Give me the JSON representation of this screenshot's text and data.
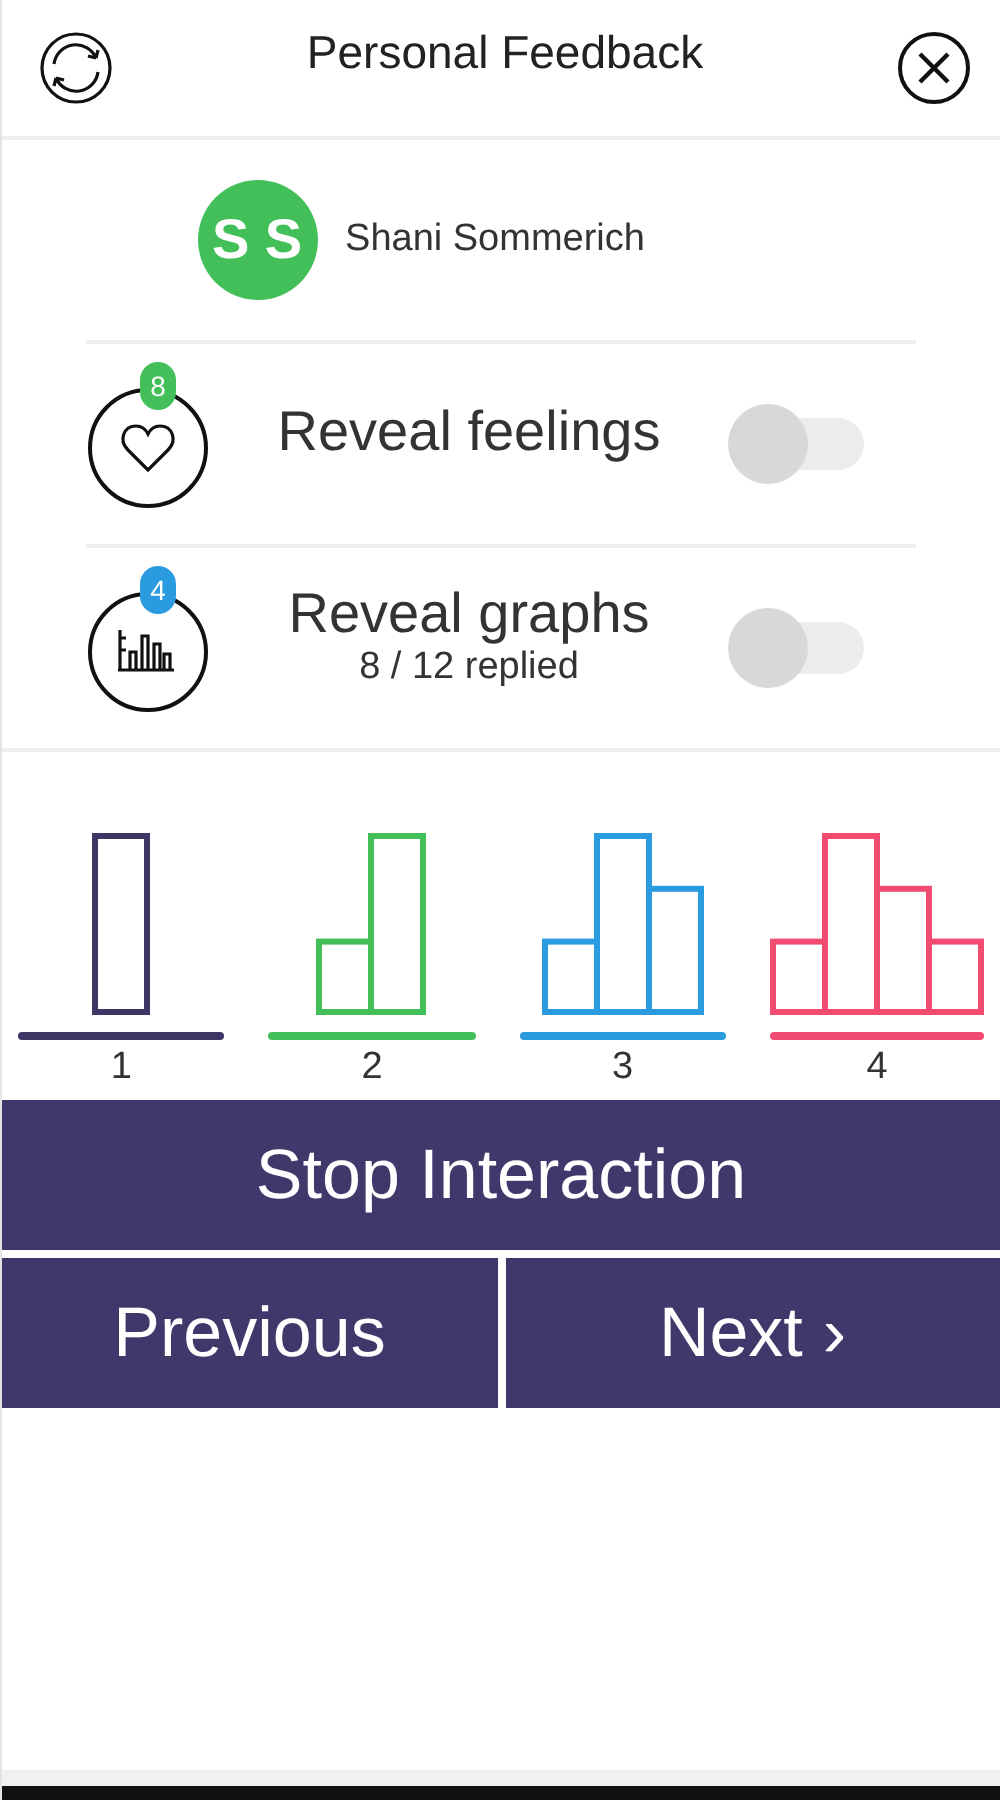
{
  "header": {
    "title": "Personal Feedback"
  },
  "user": {
    "initials": "S S",
    "name": "Shani Sommerich",
    "color": "#43bf5a"
  },
  "reveal_options": [
    {
      "kind": "feelings",
      "label": "Reveal feelings",
      "badge": "8",
      "color": "#43bf5a",
      "on": false
    },
    {
      "kind": "graphs",
      "label": "Reveal graphs",
      "subtitle": "8 / 12 replied",
      "badge": "4",
      "color": "#2b9be0",
      "on": false
    }
  ],
  "answer_options": [
    {
      "label": "1",
      "color": "#3f3565"
    },
    {
      "label": "2",
      "color": "#43bf5a"
    },
    {
      "label": "3",
      "color": "#2b9be0"
    },
    {
      "label": "4",
      "color": "#f24b72"
    }
  ],
  "buttons": {
    "stop": "Stop Interaction",
    "previous": "Previous",
    "next": "Next",
    "next_arrow": "›"
  }
}
